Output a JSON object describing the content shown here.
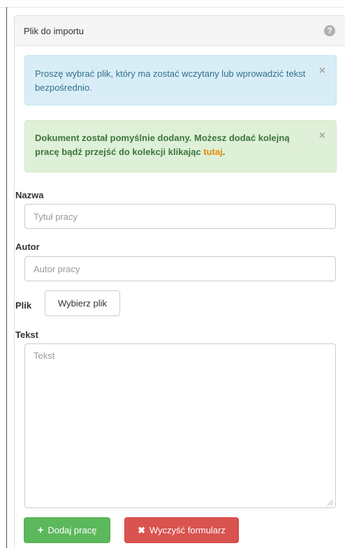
{
  "panel": {
    "title": "Plik do importu",
    "help_icon": "question-circle-icon"
  },
  "alerts": {
    "info": {
      "text": "Proszę wybrać plik, który ma zostać wczytany lub wprowadzić tekst bezpośrednio.",
      "close": "×"
    },
    "success": {
      "text": "Dokument został pomyślnie dodany. Możesz dodać kolejną pracę bądź przejść do kolekcji klikając ",
      "link": "tutaj",
      "after": ".",
      "close": "×"
    }
  },
  "form": {
    "nazwa_label": "Nazwa",
    "nazwa_placeholder": "Tytuł pracy",
    "autor_label": "Autor",
    "autor_placeholder": "Autor pracy",
    "plik_label": "Plik",
    "plik_button": "Wybierz plik",
    "tekst_label": "Tekst",
    "tekst_placeholder": "Tekst"
  },
  "buttons": {
    "add_label": "Dodaj pracę",
    "add_icon": "+",
    "clear_label": "Wyczyść formularz",
    "clear_icon": "✖"
  },
  "colors": {
    "success_button": "#5cb85c",
    "danger_button": "#d9534f",
    "info_alert": "#d9edf7",
    "success_alert": "#dff0d8",
    "link": "#e28a0a"
  }
}
